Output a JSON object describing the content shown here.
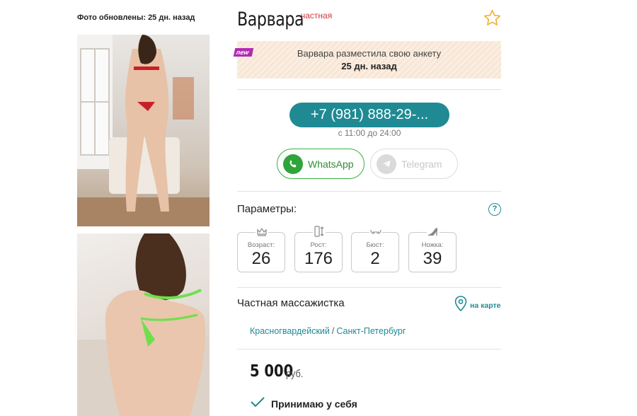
{
  "photos": {
    "updated_caption": "Фото обновлены: 25 дн. назад"
  },
  "profile": {
    "name": "Варвара",
    "badge": "частная"
  },
  "notice": {
    "tag": "new",
    "line1": "Варвара разместила свою анкету",
    "line2": "25 дн. назад"
  },
  "contact": {
    "phone": "+7 (981) 888-29-...",
    "hours": "с 11:00 до 24:00",
    "whatsapp_label": "WhatsApp",
    "telegram_label": "Telegram"
  },
  "params": {
    "title": "Параметры:",
    "help": "?",
    "items": [
      {
        "label": "Возраст:",
        "value": "26",
        "icon": "crown-icon"
      },
      {
        "label": "Рост:",
        "value": "176",
        "icon": "height-icon"
      },
      {
        "label": "Бюст:",
        "value": "2",
        "icon": "bust-icon"
      },
      {
        "label": "Ножка:",
        "value": "39",
        "icon": "heel-icon"
      }
    ]
  },
  "service": {
    "title": "Частная массажистка",
    "map_label": "на карте",
    "district": "Красногвардейский",
    "separator": "/",
    "city": "Санкт-Петербург"
  },
  "price": {
    "value": "5 000",
    "currency": "руб."
  },
  "accept": {
    "label": "Принимаю у себя"
  },
  "colors": {
    "accent": "#1f8a93",
    "whatsapp": "#2fa43a",
    "badge": "#d0363a",
    "star": "#f2b233"
  }
}
